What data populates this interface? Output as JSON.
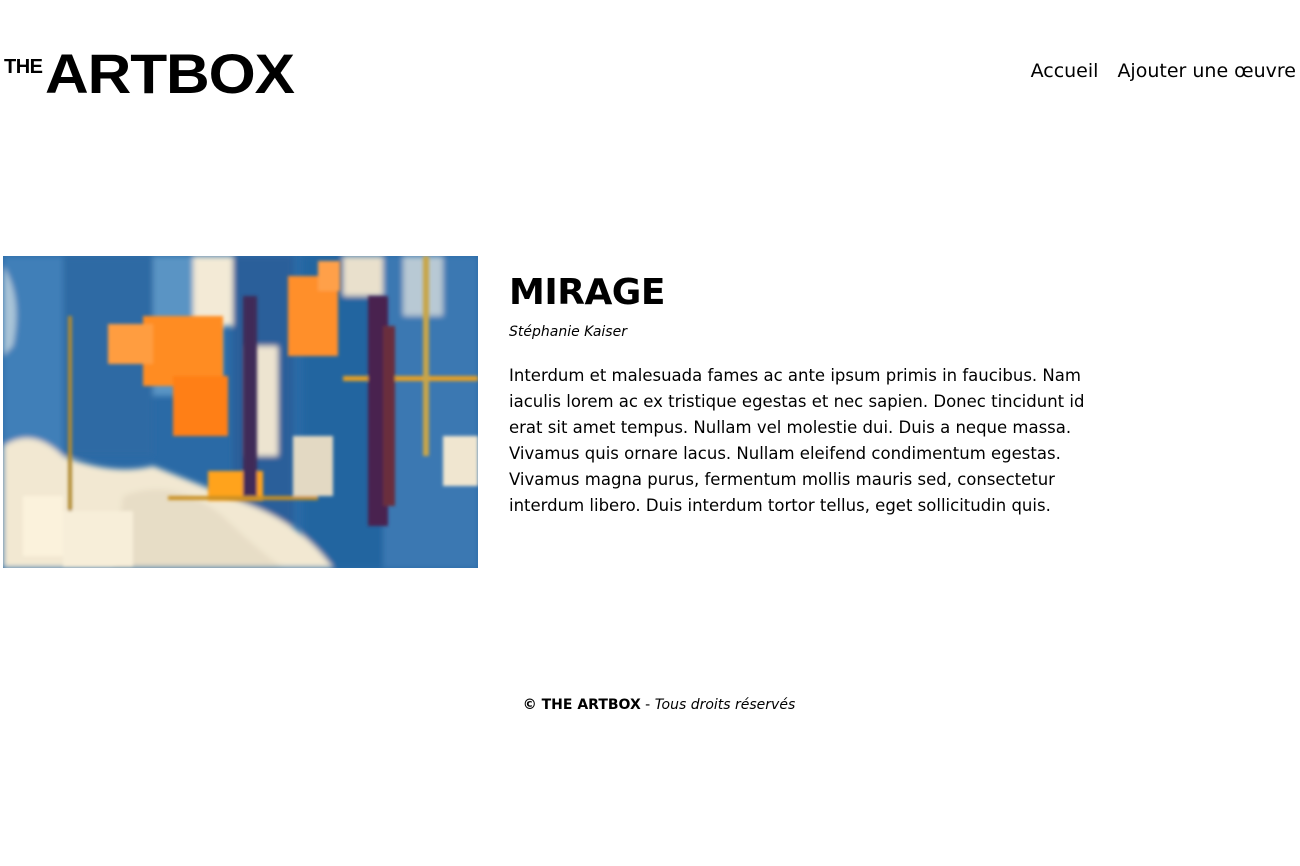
{
  "header": {
    "logo_the": "THE",
    "logo_main": "ARTBOX",
    "nav": [
      {
        "label": "Accueil"
      },
      {
        "label": "Ajouter une œuvre"
      }
    ]
  },
  "artwork": {
    "title": "MIRAGE",
    "artist": "Stéphanie Kaiser",
    "description": "Interdum et malesuada fames ac ante ipsum primis in faucibus. Nam iaculis lorem ac ex tristique egestas et nec sapien. Donec tincidunt id erat sit amet tempus. Nullam vel molestie dui. Duis a neque massa. Vivamus quis ornare lacus. Nullam eleifend condimentum egestas. Vivamus magna purus, fermentum mollis mauris sed, consectetur interdum libero. Duis interdum tortor tellus, eget sollicitudin quis.",
    "colors": {
      "blue": "#2f6fa8",
      "deep_blue": "#1c4a80",
      "orange": "#ff8a1f",
      "cream": "#f5ead0",
      "purple": "#4a2a55"
    }
  },
  "footer": {
    "brand": "© THE ARTBOX",
    "separator": " - ",
    "rights": "Tous droits réservés"
  }
}
